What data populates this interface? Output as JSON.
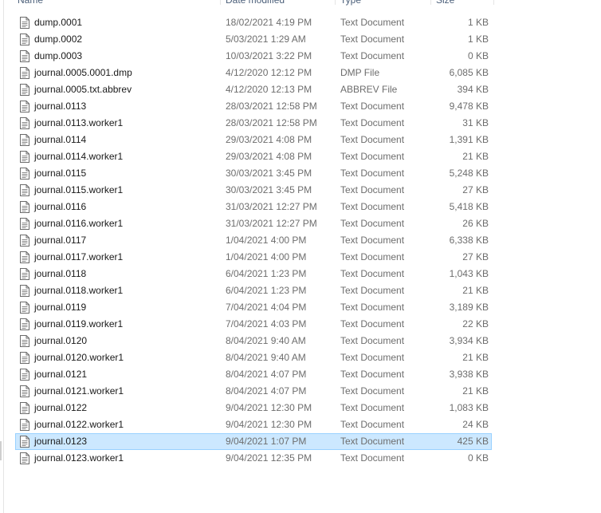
{
  "columns": {
    "name": "Name",
    "date": "Date modified",
    "type": "Type",
    "size": "Size"
  },
  "selected_index": 25,
  "selection_color": "#cce8ff",
  "icon": "document-icon",
  "files": [
    {
      "name": "dump.0001",
      "date": "18/02/2021 4:19 PM",
      "type": "Text Document",
      "size": "1 KB"
    },
    {
      "name": "dump.0002",
      "date": "5/03/2021 1:29 AM",
      "type": "Text Document",
      "size": "1 KB"
    },
    {
      "name": "dump.0003",
      "date": "10/03/2021 3:22 PM",
      "type": "Text Document",
      "size": "0 KB"
    },
    {
      "name": "journal.0005.0001.dmp",
      "date": "4/12/2020 12:12 PM",
      "type": "DMP File",
      "size": "6,085 KB"
    },
    {
      "name": "journal.0005.txt.abbrev",
      "date": "4/12/2020 12:13 PM",
      "type": "ABBREV File",
      "size": "394 KB"
    },
    {
      "name": "journal.0113",
      "date": "28/03/2021 12:58 PM",
      "type": "Text Document",
      "size": "9,478 KB"
    },
    {
      "name": "journal.0113.worker1",
      "date": "28/03/2021 12:58 PM",
      "type": "Text Document",
      "size": "31 KB"
    },
    {
      "name": "journal.0114",
      "date": "29/03/2021 4:08 PM",
      "type": "Text Document",
      "size": "1,391 KB"
    },
    {
      "name": "journal.0114.worker1",
      "date": "29/03/2021 4:08 PM",
      "type": "Text Document",
      "size": "21 KB"
    },
    {
      "name": "journal.0115",
      "date": "30/03/2021 3:45 PM",
      "type": "Text Document",
      "size": "5,248 KB"
    },
    {
      "name": "journal.0115.worker1",
      "date": "30/03/2021 3:45 PM",
      "type": "Text Document",
      "size": "27 KB"
    },
    {
      "name": "journal.0116",
      "date": "31/03/2021 12:27 PM",
      "type": "Text Document",
      "size": "5,418 KB"
    },
    {
      "name": "journal.0116.worker1",
      "date": "31/03/2021 12:27 PM",
      "type": "Text Document",
      "size": "26 KB"
    },
    {
      "name": "journal.0117",
      "date": "1/04/2021 4:00 PM",
      "type": "Text Document",
      "size": "6,338 KB"
    },
    {
      "name": "journal.0117.worker1",
      "date": "1/04/2021 4:00 PM",
      "type": "Text Document",
      "size": "27 KB"
    },
    {
      "name": "journal.0118",
      "date": "6/04/2021 1:23 PM",
      "type": "Text Document",
      "size": "1,043 KB"
    },
    {
      "name": "journal.0118.worker1",
      "date": "6/04/2021 1:23 PM",
      "type": "Text Document",
      "size": "21 KB"
    },
    {
      "name": "journal.0119",
      "date": "7/04/2021 4:04 PM",
      "type": "Text Document",
      "size": "3,189 KB"
    },
    {
      "name": "journal.0119.worker1",
      "date": "7/04/2021 4:03 PM",
      "type": "Text Document",
      "size": "22 KB"
    },
    {
      "name": "journal.0120",
      "date": "8/04/2021 9:40 AM",
      "type": "Text Document",
      "size": "3,934 KB"
    },
    {
      "name": "journal.0120.worker1",
      "date": "8/04/2021 9:40 AM",
      "type": "Text Document",
      "size": "21 KB"
    },
    {
      "name": "journal.0121",
      "date": "8/04/2021 4:07 PM",
      "type": "Text Document",
      "size": "3,938 KB"
    },
    {
      "name": "journal.0121.worker1",
      "date": "8/04/2021 4:07 PM",
      "type": "Text Document",
      "size": "21 KB"
    },
    {
      "name": "journal.0122",
      "date": "9/04/2021 12:30 PM",
      "type": "Text Document",
      "size": "1,083 KB"
    },
    {
      "name": "journal.0122.worker1",
      "date": "9/04/2021 12:30 PM",
      "type": "Text Document",
      "size": "24 KB"
    },
    {
      "name": "journal.0123",
      "date": "9/04/2021 1:07 PM",
      "type": "Text Document",
      "size": "425 KB"
    },
    {
      "name": "journal.0123.worker1",
      "date": "9/04/2021 12:35 PM",
      "type": "Text Document",
      "size": "0 KB"
    }
  ]
}
